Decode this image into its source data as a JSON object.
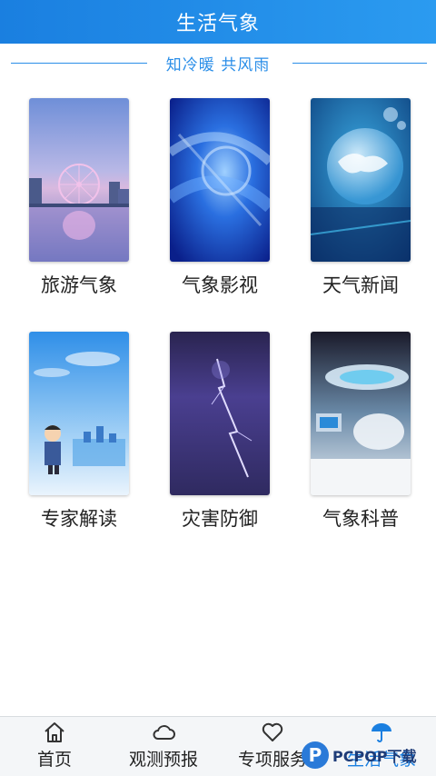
{
  "header": {
    "title": "生活气象"
  },
  "slogan": "知冷暖 共风雨",
  "tiles": [
    {
      "label": "旅游气象",
      "icon": "ferris-wheel-photo"
    },
    {
      "label": "气象影视",
      "icon": "blue-abstract-photo"
    },
    {
      "label": "天气新闻",
      "icon": "globe-photo"
    },
    {
      "label": "专家解读",
      "icon": "expert-cartoon-photo"
    },
    {
      "label": "灾害防御",
      "icon": "lightning-photo"
    },
    {
      "label": "气象科普",
      "icon": "science-hall-photo"
    }
  ],
  "bottom_nav": [
    {
      "label": "首页",
      "icon": "home-icon"
    },
    {
      "label": "观测预报",
      "icon": "cloud-icon"
    },
    {
      "label": "专项服务",
      "icon": "heart-icon"
    },
    {
      "label": "生活气象",
      "icon": "umbrella-icon",
      "active": true
    }
  ],
  "watermark": {
    "text": "PCPOP下载"
  },
  "colors": {
    "accent": "#1a7fe0",
    "slogan": "#2a8ee8",
    "text": "#222222"
  }
}
